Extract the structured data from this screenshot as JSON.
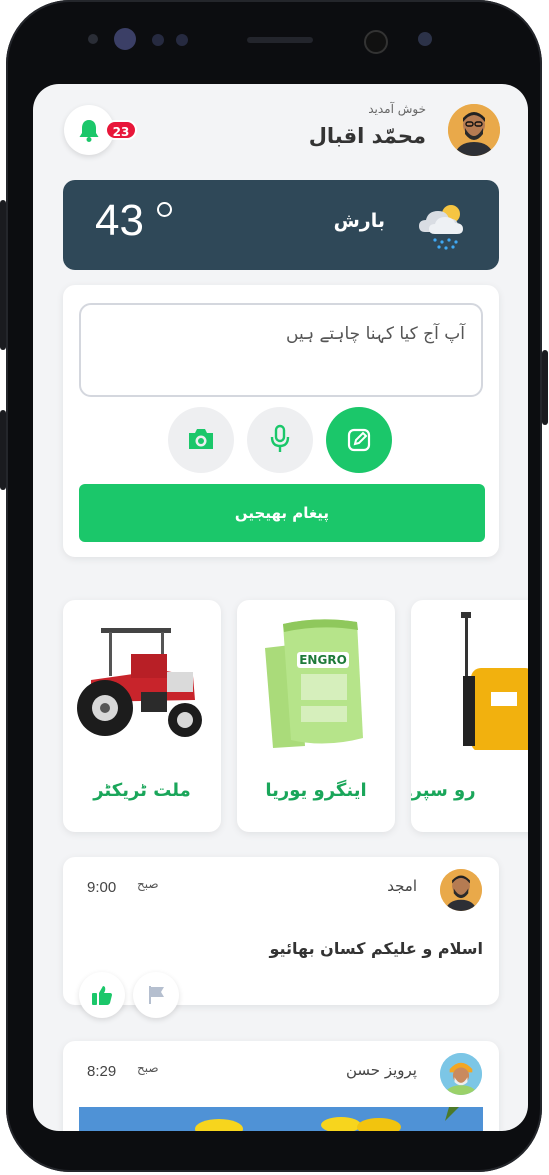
{
  "header": {
    "greeting": "خوش آمدید",
    "username": "محمّد اقبال",
    "notification_count": "23"
  },
  "weather": {
    "temperature": "43",
    "condition": "بارش",
    "icon": "cloud-rain-sun-icon"
  },
  "composer": {
    "placeholder": "آپ آج کیا کہنا چاہتے ہیں",
    "actions": [
      "camera-icon",
      "microphone-icon",
      "edit-icon"
    ],
    "send_label": "پیغام بھیجیں"
  },
  "products": [
    {
      "title": "ملت ٹریکٹر",
      "image": "tractor"
    },
    {
      "title": "اینگرو یوریا",
      "image": "fertilizer-bag"
    },
    {
      "title": "رو سپرے",
      "image": "sprayer"
    }
  ],
  "posts": [
    {
      "author": "امجد",
      "period": "صبح",
      "time": "9:00",
      "text": "اسلام و علیکم کسان بھائیو",
      "reactions": [
        "thumbs-up-icon",
        "flag-icon"
      ]
    },
    {
      "author": "پرویز حسن",
      "period": "صبح",
      "time": "8:29",
      "text": "",
      "image": "sunflower-field"
    }
  ],
  "colors": {
    "accent": "#1bc76a",
    "weather_card": "#2f4858",
    "badge": "#e8173a",
    "product_title": "#1aa65a"
  }
}
